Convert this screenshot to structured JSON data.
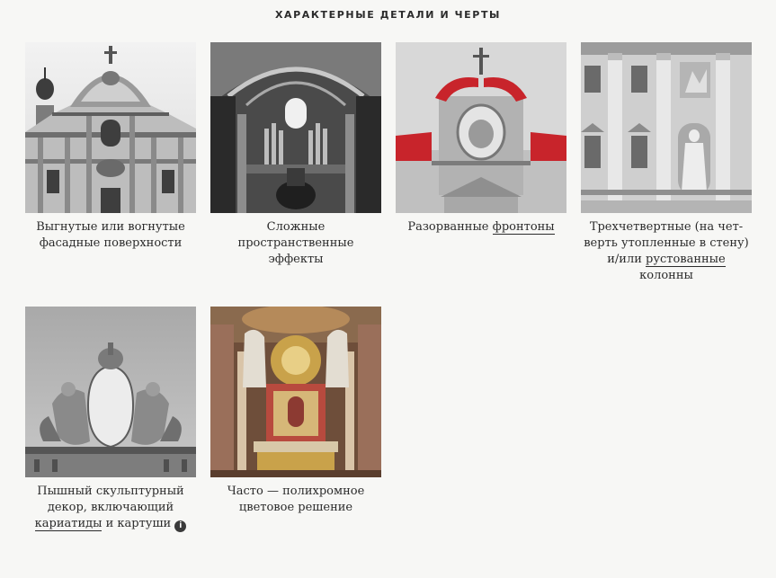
{
  "section": {
    "title": "ХАРАКТЕРНЫЕ ДЕТАЛИ И ЧЕРТЫ"
  },
  "cards": [
    {
      "line1": "Выгнутые или вогнутые",
      "line2": "фасадные поверхности",
      "image_icon": "curved-facade-photo"
    },
    {
      "line1": "Сложные",
      "line2": "пространственные",
      "line3": "эффекты",
      "image_icon": "church-interior-photo"
    },
    {
      "before": "Разорванные ",
      "link": "фронтоны",
      "image_icon": "broken-pediment-photo"
    },
    {
      "line1": "Трехчетвертные (на чет-",
      "line2": "верть утопленные в стену)",
      "line3_before": "и/или ",
      "line3_link": "рустованные",
      "line4": "колонны",
      "image_icon": "columns-facade-photo"
    },
    {
      "line1": "Пышный скульптурный",
      "line2": "декор, включающий",
      "line3_link": "кариатиды",
      "line3_after": " и картуши",
      "info_glyph": "i",
      "image_icon": "sculptural-cartouche-photo"
    },
    {
      "line1": "Часто — полихромное",
      "line2": "цветовое решение",
      "image_icon": "polychrome-altar-photo"
    }
  ],
  "colors": {
    "background": "#f7f7f5",
    "text": "#2b2b2b",
    "accent_red": "#c8242b",
    "altar_gold": "#c9a24a"
  }
}
